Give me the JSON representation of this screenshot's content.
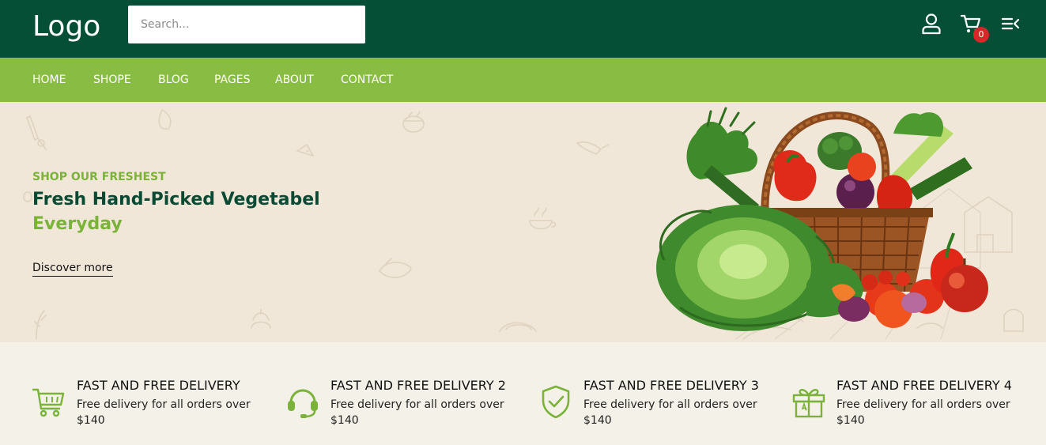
{
  "header": {
    "logo": "Logo",
    "search_placeholder": "Search...",
    "account_icon": "user-icon",
    "cart_icon": "cart-icon",
    "cart_count": "0",
    "menu_icon": "menu-icon"
  },
  "nav": {
    "items": [
      {
        "label": "HOME"
      },
      {
        "label": "SHOPE"
      },
      {
        "label": "BLOG"
      },
      {
        "label": "PAGES"
      },
      {
        "label": "ABOUT"
      },
      {
        "label": "CONTACT"
      }
    ]
  },
  "hero": {
    "kicker": "SHOP OUR FRESHEST",
    "title_line1": "Fresh Hand-Picked Vegetabel",
    "title_line2": "Everyday",
    "cta": "Discover more",
    "image": "vegetable-basket-image"
  },
  "features": [
    {
      "title": "FAST AND FREE DELIVERY",
      "desc": "Free delivery for all orders over $140",
      "icon": "shopping-cart-icon"
    },
    {
      "title": "FAST AND FREE DELIVERY 2",
      "desc": "Free delivery for all orders over $140",
      "icon": "headset-icon"
    },
    {
      "title": "FAST AND FREE DELIVERY 3",
      "desc": "Free delivery for all orders over $140",
      "icon": "shield-check-icon"
    },
    {
      "title": "FAST AND FREE DELIVERY 4",
      "desc": "Free delivery for all orders over $140",
      "icon": "gift-icon"
    }
  ],
  "colors": {
    "header_bg": "#044f36",
    "nav_bg": "#88bc43",
    "hero_bg": "#f1e7d8",
    "accent_green": "#7bb23a",
    "dark_green": "#0a4a33",
    "badge_red": "#d62828"
  }
}
